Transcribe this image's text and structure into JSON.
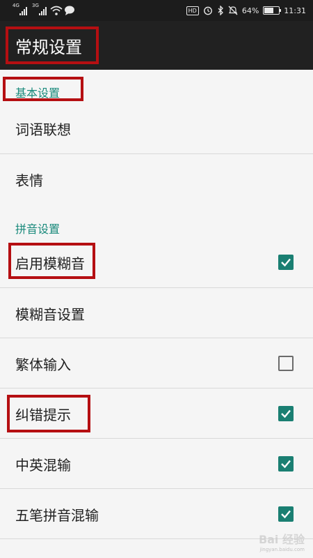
{
  "status_bar": {
    "sim1_network": "4G",
    "sim2_network": "3G",
    "hd_label": "HD",
    "battery_percent_text": "64%",
    "battery_level": 0.64,
    "time": "11:31"
  },
  "app_bar": {
    "title": "常规设置"
  },
  "sections": {
    "basic": {
      "header": "基本设置",
      "items": [
        {
          "label": "词语联想"
        },
        {
          "label": "表情"
        }
      ]
    },
    "pinyin": {
      "header": "拼音设置",
      "items": [
        {
          "label": "启用模糊音",
          "checked": true
        },
        {
          "label": "模糊音设置"
        },
        {
          "label": "繁体输入",
          "checked": false
        },
        {
          "label": "纠错提示",
          "checked": true
        },
        {
          "label": "中英混输",
          "checked": true
        },
        {
          "label": "五笔拼音混输",
          "checked": true
        }
      ]
    }
  },
  "watermark": {
    "brand": "Bai 经验",
    "url": "jingyan.baidu.com"
  },
  "colors": {
    "accent": "#1a8a7c",
    "checkbox_on": "#1a7f72",
    "highlight_box": "#b50f12",
    "app_bar": "#212121"
  }
}
